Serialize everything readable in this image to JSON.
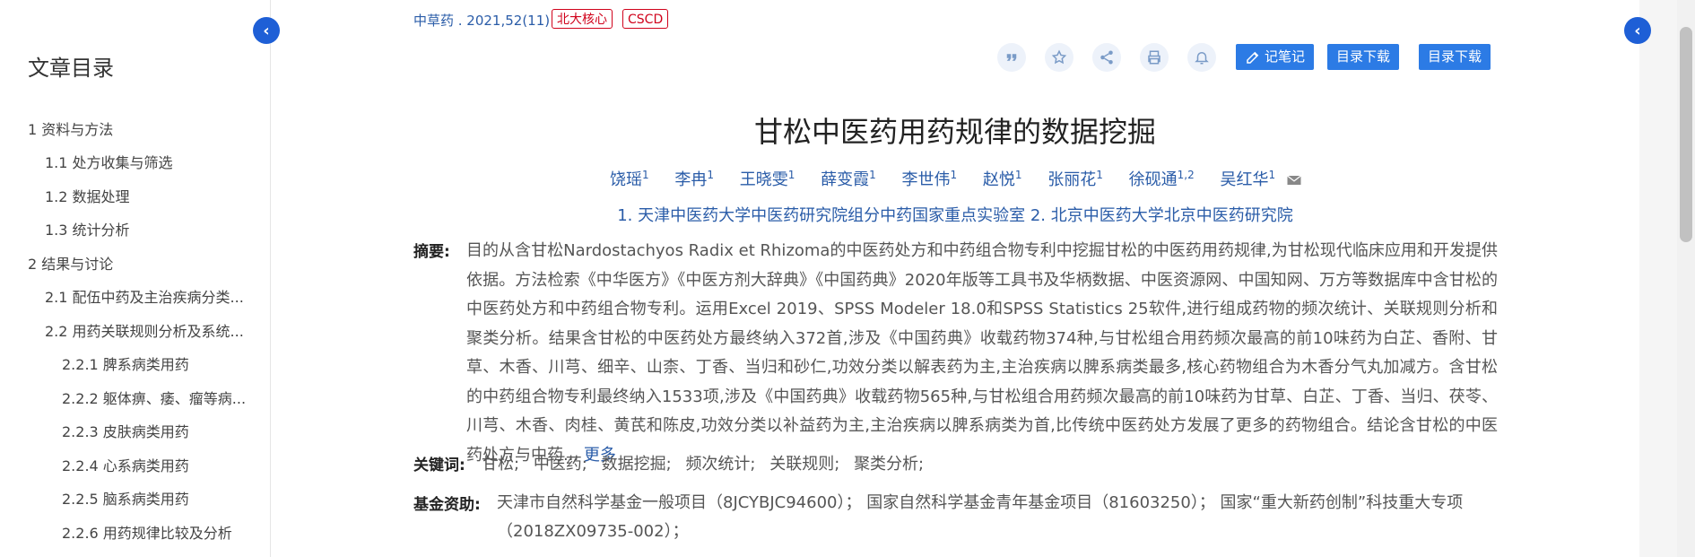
{
  "sidebar": {
    "title": "文章目录",
    "items": [
      {
        "label": "1 资料与方法"
      },
      {
        "label": "1.1 处方收集与筛选"
      },
      {
        "label": "1.2 数据处理"
      },
      {
        "label": "1.3 统计分析"
      },
      {
        "label": "2 结果与讨论"
      },
      {
        "label": "2.1 配伍中药及主治疾病分类..."
      },
      {
        "label": "2.2 用药关联规则分析及系统..."
      },
      {
        "label": "2.2.1 脾系病类用药"
      },
      {
        "label": "2.2.2 躯体痹、痿、瘤等病..."
      },
      {
        "label": "2.2.3 皮肤病类用药"
      },
      {
        "label": "2.2.4 心系病类用药"
      },
      {
        "label": "2.2.5 脑系病类用药"
      },
      {
        "label": "2.2.6 用药规律比较及分析"
      }
    ],
    "collapse_icon": "chevron-left"
  },
  "header": {
    "source": "中草药 . 2021,52(11)",
    "badges": [
      "北大核心",
      "CSCD"
    ],
    "icons": [
      "quote-icon",
      "star-icon",
      "share-icon",
      "print-icon",
      "bell-icon"
    ],
    "note_button": "记笔记",
    "toc_download_1": "目录下载",
    "toc_download_2": "目录下载"
  },
  "article": {
    "title": "甘松中医药用药规律的数据挖掘",
    "authors": [
      {
        "name": "饶瑶",
        "sup": "1"
      },
      {
        "name": "李冉",
        "sup": "1"
      },
      {
        "name": "王晓雯",
        "sup": "1"
      },
      {
        "name": "薛变霞",
        "sup": "1"
      },
      {
        "name": "李世伟",
        "sup": "1"
      },
      {
        "name": "赵悦",
        "sup": "1"
      },
      {
        "name": "张丽花",
        "sup": "1"
      },
      {
        "name": "徐砚通",
        "sup": "1,2"
      },
      {
        "name": "吴红华",
        "sup": "1"
      }
    ],
    "affiliations": "1. 天津中医药大学中医药研究院组分中药国家重点实验室   2. 北京中医药大学北京中医药研究院",
    "abstract_label": "摘要:",
    "abstract": "目的从含甘松Nardostachyos Radix et Rhizoma的中医药处方和中药组合物专利中挖掘甘松的中医药用药规律,为甘松现代临床应用和开发提供依据。方法检索《中华医方》《中医方剂大辞典》《中国药典》2020年版等工具书及华柄数据、中医资源网、中国知网、万方等数据库中含甘松的中医药处方和中药组合物专利。运用Excel 2019、SPSS Modeler 18.0和SPSS Statistics 25软件,进行组成药物的频次统计、关联规则分析和聚类分析。结果含甘松的中医药处方最终纳入372首,涉及《中国药典》收载药物374种,与甘松组合用药频次最高的前10味药为白芷、香附、甘草、木香、川芎、细辛、山柰、丁香、当归和砂仁,功效分类以解表药为主,主治疾病以脾系病类最多,核心药物组合为木香分气丸加减方。含甘松的中药组合物专利最终纳入1533项,涉及《中国药典》收载药物565种,与甘松组合用药频次最高的前10味药为甘草、白芷、丁香、当归、茯苓、川芎、木香、肉桂、黄芪和陈皮,功效分类以补益药为主,主治疾病以脾系病类为首,比传统中医药处方发展了更多的药物组合。结论含甘松的中医药处方与中药...",
    "more_label": "更多",
    "keywords_label": "关键词:",
    "keywords": [
      "甘松;",
      "中医药;",
      "数据挖掘;",
      "频次统计;",
      "关联规则;",
      "聚类分析;"
    ],
    "fund_label": "基金资助:",
    "fund": "天津市自然科学基金一般项目（8JCYBJC94600）； 国家自然科学基金青年基金项目（81603250）； 国家“重大新药创制”科技重大专项（2018ZX09735-002）；"
  },
  "colors": {
    "accent": "#2c7be5",
    "link": "#2a5ca8",
    "badge_red": "#d0021b",
    "collapse_btn": "#1e5fd6"
  }
}
